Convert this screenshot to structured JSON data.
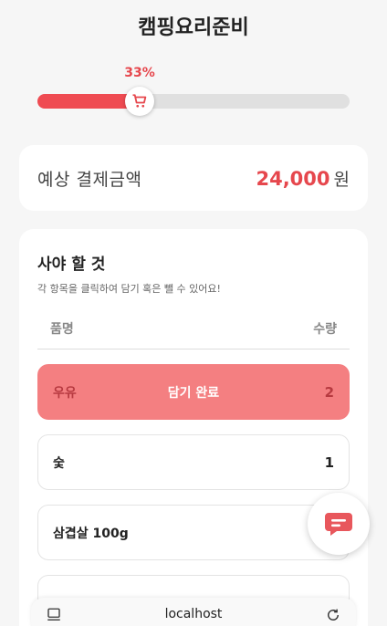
{
  "header": {
    "title": "캠핑요리준비"
  },
  "progress": {
    "label": "33%",
    "value": 0.33
  },
  "estimate": {
    "label": "예상 결제금액",
    "amount": "24,000",
    "unit": "원"
  },
  "list": {
    "title": "사야 할 것",
    "subtitle": "각 항목을 클릭하여 담기 혹은 뺄 수 있어요!",
    "columns": {
      "name": "품명",
      "qty": "수량"
    },
    "items": [
      {
        "name": "우유",
        "status": "담기 완료",
        "qty": "2"
      },
      {
        "name": "숯",
        "status": "",
        "qty": "1"
      },
      {
        "name": "삼겹살 100g",
        "status": "",
        "qty": ""
      }
    ]
  },
  "browser": {
    "url": "localhost"
  },
  "colors": {
    "accent": "#ef4b52",
    "done": "#f47f81"
  }
}
